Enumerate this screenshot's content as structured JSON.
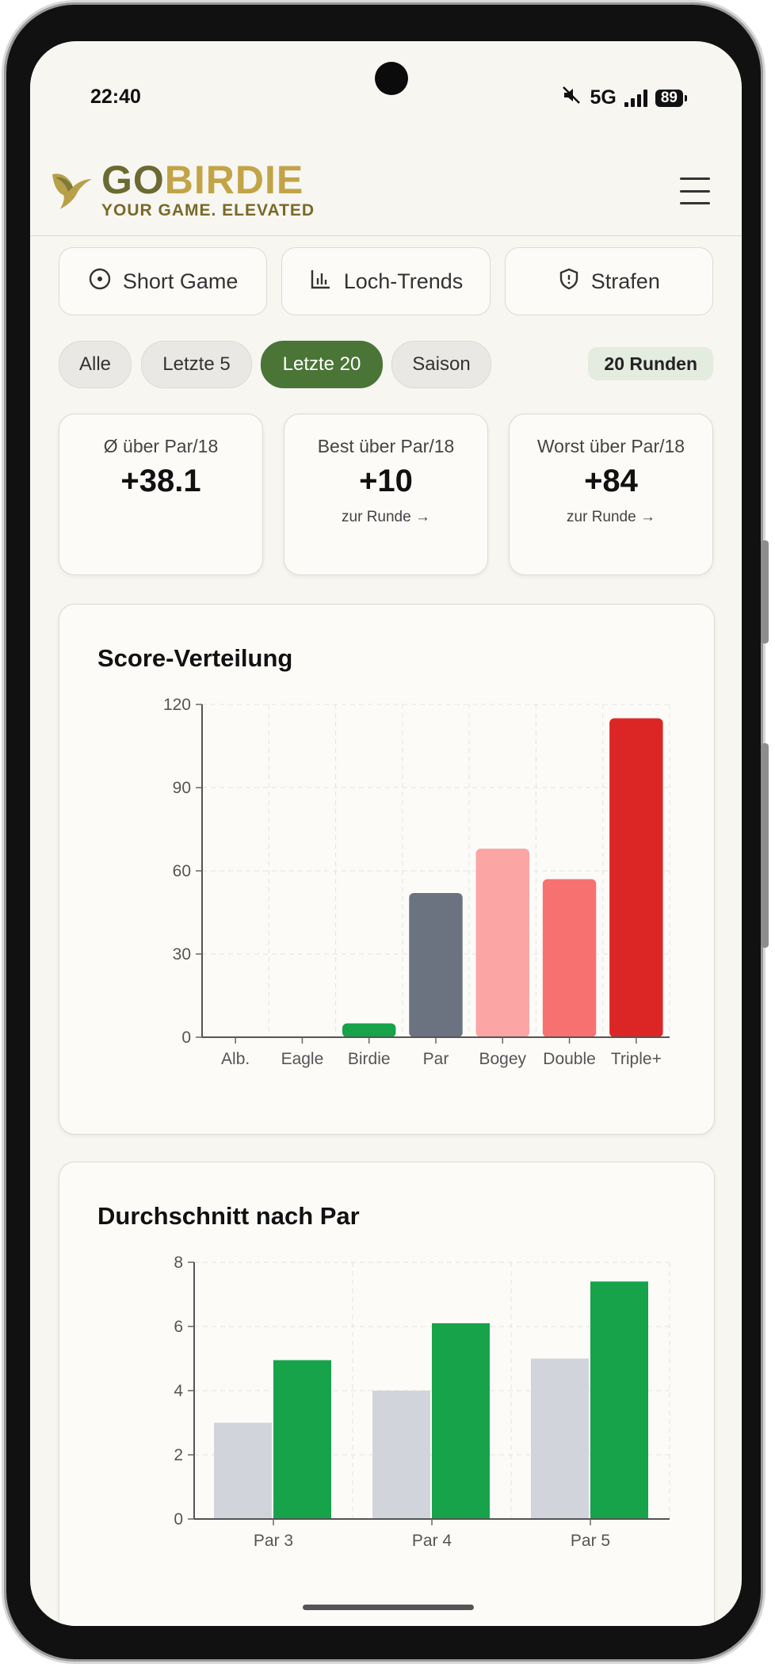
{
  "status_bar": {
    "time": "22:40",
    "network": "5G",
    "battery": "89"
  },
  "header": {
    "logo_go": "GO",
    "logo_birdie": "BIRDIE",
    "tagline": "YOUR GAME. ELEVATED"
  },
  "tabs": [
    {
      "label": "Short Game",
      "icon": "target-icon"
    },
    {
      "label": "Loch-Trends",
      "icon": "bar-chart-icon"
    },
    {
      "label": "Strafen",
      "icon": "shield-icon"
    }
  ],
  "filters": [
    {
      "label": "Alle",
      "active": false
    },
    {
      "label": "Letzte 5",
      "active": false
    },
    {
      "label": "Letzte 20",
      "active": true
    },
    {
      "label": "Saison",
      "active": false
    }
  ],
  "rounds_badge": "20 Runden",
  "stats": [
    {
      "label": "Ø über Par/18",
      "value": "+38.1",
      "link": ""
    },
    {
      "label": "Best über Par/18",
      "value": "+10",
      "link": "zur Runde →"
    },
    {
      "label": "Worst über Par/18",
      "value": "+84",
      "link": "zur Runde →"
    }
  ],
  "colors": {
    "accent": "#4a7536",
    "logo_go": "#6b6a33",
    "logo_birdie": "#c2a447"
  },
  "chart_data": [
    {
      "title": "Score-Verteilung",
      "type": "bar",
      "categories": [
        "Alb.",
        "Eagle",
        "Birdie",
        "Par",
        "Bogey",
        "Double",
        "Triple+"
      ],
      "values": [
        0,
        0,
        5,
        52,
        68,
        57,
        115
      ],
      "colors": [
        "#16a34a",
        "#16a34a",
        "#16a34a",
        "#6b7280",
        "#fca5a5",
        "#f87171",
        "#dc2626"
      ],
      "ylim": [
        0,
        120
      ],
      "yticks": [
        0,
        30,
        60,
        90,
        120
      ],
      "grid": true
    },
    {
      "title": "Durchschnitt nach Par",
      "type": "bar",
      "categories": [
        "Par 3",
        "Par 4",
        "Par 5"
      ],
      "series": [
        {
          "values": [
            3,
            4,
            5
          ],
          "color": "#d1d5db"
        },
        {
          "values": [
            4.95,
            6.1,
            7.4
          ],
          "color": "#16a34a"
        }
      ],
      "ylim": [
        0,
        8
      ],
      "yticks": [
        0,
        2,
        4,
        6,
        8
      ],
      "grid": true
    }
  ]
}
